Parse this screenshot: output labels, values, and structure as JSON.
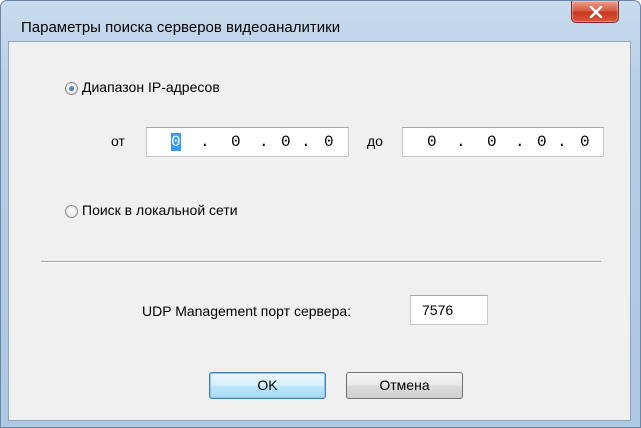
{
  "window": {
    "title": "Параметры поиска серверов видеоаналитики",
    "close_symbol": "x"
  },
  "range_option": {
    "label": "Диапазон IP-адресов",
    "selected": true,
    "from_label": "от",
    "to_label": "до",
    "from_ip": [
      "0",
      "0",
      "0",
      "0"
    ],
    "to_ip": [
      "0",
      "0",
      "0",
      "0"
    ],
    "dot": "."
  },
  "local_option": {
    "label": "Поиск в локальной сети",
    "selected": false
  },
  "port": {
    "label": "UDP Management порт сервера:",
    "value": "7576"
  },
  "buttons": {
    "ok": "OK",
    "cancel": "Отмена"
  },
  "colors": {
    "selection": "#3399ff",
    "close_button": "#c8361f"
  }
}
